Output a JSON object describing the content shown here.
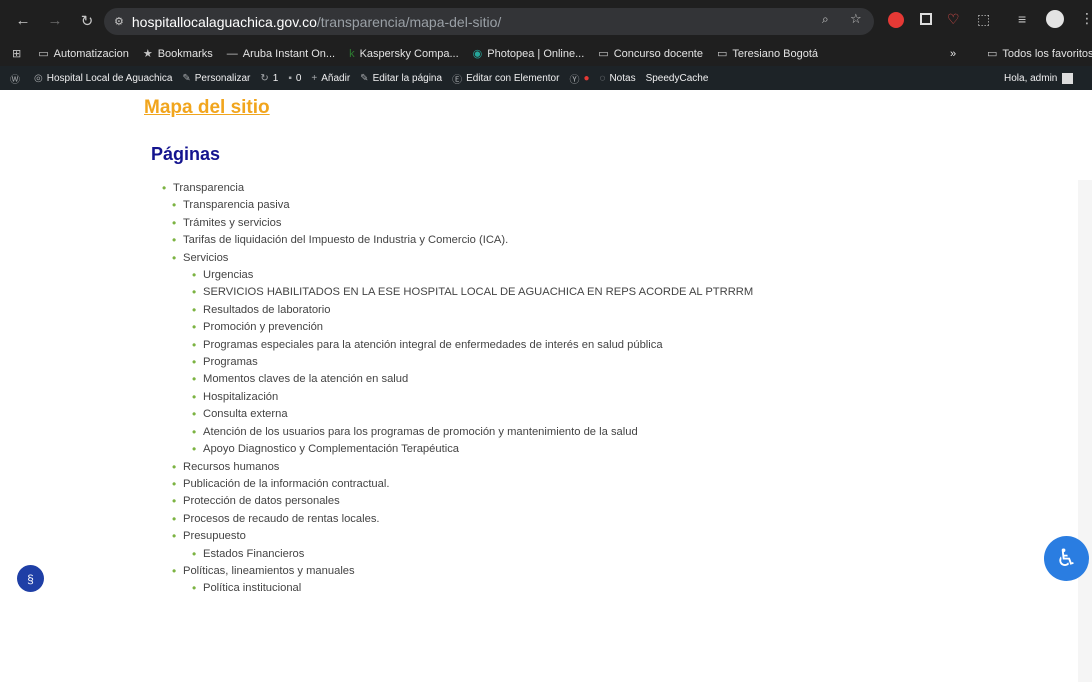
{
  "browser": {
    "url_host": "hospitallocalaguachica.gov.co",
    "url_path": "/transparencia/mapa-del-sitio/",
    "bookmarks": [
      "Automatizacion",
      "Bookmarks",
      "Aruba Instant On...",
      "Kaspersky Compa...",
      "Photopea | Online...",
      "Concurso docente",
      "Teresiano Bogotá"
    ],
    "all_bookmarks": "Todos los favoritos"
  },
  "wpbar": {
    "site": "Hospital Local de Aguachica",
    "customize": "Personalizar",
    "updates": "1",
    "comments": "0",
    "add": "Añadir",
    "edit_page": "Editar la página",
    "elementor": "Editar con Elementor",
    "notes": "Notas",
    "speedy": "SpeedyCache",
    "greeting": "Hola, admin"
  },
  "page": {
    "title": "Mapa del sitio",
    "section": "Páginas",
    "tree": [
      {
        "label": "Transparencia",
        "children": [
          {
            "label": "Transparencia pasiva"
          },
          {
            "label": "Trámites y servicios"
          },
          {
            "label": "Tarifas de liquidación del Impuesto de Industria y Comercio (ICA)."
          },
          {
            "label": "Servicios",
            "children": [
              {
                "label": "Urgencias"
              },
              {
                "label": "SERVICIOS HABILITADOS EN LA ESE HOSPITAL LOCAL DE AGUACHICA EN REPS ACORDE AL PTRRRM"
              },
              {
                "label": "Resultados de laboratorio"
              },
              {
                "label": "Promoción y prevención"
              },
              {
                "label": "Programas especiales para la atención integral de enfermedades de interés en salud pública"
              },
              {
                "label": "Programas"
              },
              {
                "label": "Momentos claves de la atención en salud"
              },
              {
                "label": "Hospitalización"
              },
              {
                "label": "Consulta externa"
              },
              {
                "label": "Atención de los usuarios para los programas de promoción y mantenimiento de la salud"
              },
              {
                "label": "Apoyo Diagnostico y Complementación Terapéutica"
              }
            ]
          },
          {
            "label": "Recursos humanos"
          },
          {
            "label": "Publicación de la información contractual."
          },
          {
            "label": "Protección de datos personales"
          },
          {
            "label": "Procesos de recaudo de rentas locales."
          },
          {
            "label": "Presupuesto",
            "children": [
              {
                "label": "Estados Financieros"
              }
            ]
          },
          {
            "label": "Políticas, lineamientos y manuales",
            "children": [
              {
                "label": "Política institucional"
              }
            ]
          }
        ]
      }
    ]
  }
}
